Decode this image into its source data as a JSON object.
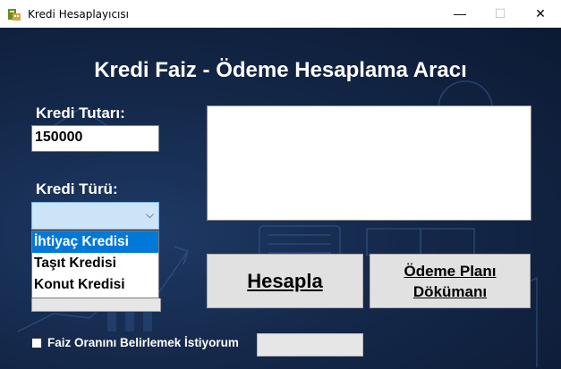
{
  "window": {
    "title": "Kredi Hesaplayıcısı",
    "min_glyph": "—",
    "max_glyph": "☐",
    "close_glyph": "✕"
  },
  "header": {
    "title": "Kredi Faiz - Ödeme Hesaplama Aracı"
  },
  "form": {
    "amount_label": "Kredi Tutarı:",
    "amount_value": "150000",
    "type_label": "Kredi Türü:",
    "type_selected": "",
    "type_options": [
      "İhtiyaç Kredisi",
      "Taşıt Kredisi",
      "Konut Kredisi"
    ],
    "highlighted_option": "İhtiyaç Kredisi"
  },
  "buttons": {
    "calculate": "Hesapla",
    "payment_plan": "Ödeme Planı Dökümanı"
  },
  "interest": {
    "checkbox_label": "Faiz Oranını Belirlemek İstiyorum",
    "checked": false,
    "rate_value": ""
  },
  "colors": {
    "background": "#14284a",
    "selection": "#0078d7",
    "combo_focus": "#cce4f7"
  },
  "icons": [
    "app-icon",
    "minimize-icon",
    "maximize-icon",
    "close-icon",
    "chevron-down-icon"
  ]
}
